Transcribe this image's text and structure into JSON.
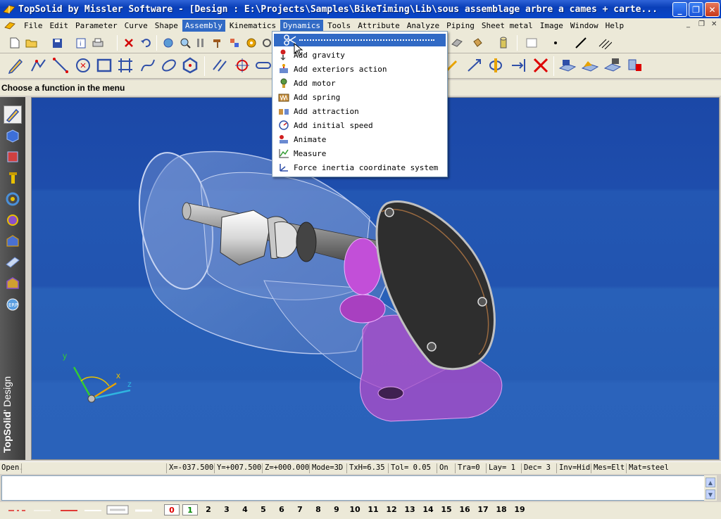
{
  "window": {
    "title": "TopSolid by Missler Software - [Design : E:\\Projects\\Samples\\BikeTiming\\Lib\\sous assemblage arbre a cames + carte...",
    "minimize_glyph": "_",
    "maximize_glyph": "❐",
    "close_glyph": "✕"
  },
  "menubar": {
    "items": [
      {
        "label": "File"
      },
      {
        "label": "Edit"
      },
      {
        "label": "Parameter"
      },
      {
        "label": "Curve"
      },
      {
        "label": "Shape"
      },
      {
        "label": "Assembly"
      },
      {
        "label": "Kinematics"
      },
      {
        "label": "Dynamics"
      },
      {
        "label": "Tools"
      },
      {
        "label": "Attribute"
      },
      {
        "label": "Analyze"
      },
      {
        "label": "Piping"
      },
      {
        "label": "Sheet metal"
      },
      {
        "label": "Image"
      },
      {
        "label": "Window"
      },
      {
        "label": "Help"
      }
    ],
    "active": "Dynamics",
    "mdi_minimize": "_",
    "mdi_restore": "❐",
    "mdi_close": "✕"
  },
  "prompt": "Choose a function in the menu",
  "dynamics_menu": {
    "items": [
      {
        "label": "Add gravity",
        "icon": "gravity-icon"
      },
      {
        "label": "Add exteriors action",
        "icon": "exterior-action-icon"
      },
      {
        "label": "Add motor",
        "icon": "motor-icon"
      },
      {
        "label": "Add spring",
        "icon": "spring-icon"
      },
      {
        "label": "Add attraction",
        "icon": "attraction-icon"
      },
      {
        "label": "Add initial speed",
        "icon": "initial-speed-icon"
      },
      {
        "label": "Animate",
        "icon": "animate-icon"
      },
      {
        "label": "Measure",
        "icon": "measure-icon"
      },
      {
        "label": "Force inertia coordinate system",
        "icon": "inertia-coordinate-icon"
      }
    ]
  },
  "brand": {
    "bold": "TopSolid",
    "rest": "' Design"
  },
  "axes": {
    "x": "x",
    "y": "y",
    "z": "z"
  },
  "status": {
    "state": "Open.",
    "x": "X=-037.500",
    "y": "Y=+007.500",
    "z": "Z=+000.000",
    "mode": "Mode=3D",
    "txh": "TxH=6.35",
    "tol": "Tol=  0.05",
    "on": "On",
    "tra": "Tra=0",
    "lay": "Lay=  1",
    "dec": "Dec= 3",
    "inv": "Inv=Hid",
    "mes": "Mes=Elt",
    "mat": "Mat=steel"
  },
  "layers": [
    "0",
    "1",
    "2",
    "3",
    "4",
    "5",
    "6",
    "7",
    "8",
    "9",
    "10",
    "11",
    "12",
    "13",
    "14",
    "15",
    "16",
    "17",
    "18",
    "19"
  ],
  "colors": {
    "title_blue": "#0845c9",
    "menu_highlight": "#316ac5",
    "viewport_blue": "#2254b0",
    "cam_purple": "#b04ac8"
  }
}
